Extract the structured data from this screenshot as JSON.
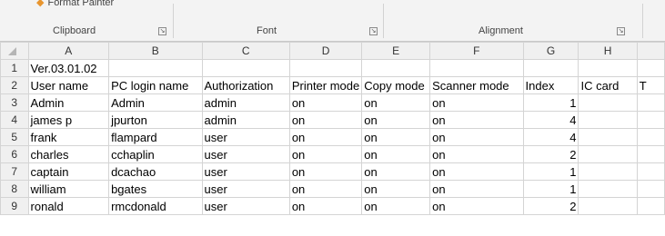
{
  "ribbon": {
    "format_painter_label": "Format Painter",
    "groups": {
      "clipboard": "Clipboard",
      "font": "Font",
      "alignment": "Alignment"
    }
  },
  "columns": [
    "A",
    "B",
    "C",
    "D",
    "E",
    "F",
    "G",
    "H"
  ],
  "rows": [
    [
      "Ver.03.01.02",
      "",
      "",
      "",
      "",
      "",
      "",
      ""
    ],
    [
      "User name",
      "PC login name",
      "Authorization",
      "Printer mode",
      "Copy mode",
      "Scanner mode",
      "Index",
      "IC card"
    ],
    [
      "Admin",
      "Admin",
      "admin",
      "on",
      "on",
      "on",
      "1",
      ""
    ],
    [
      "james p",
      "jpurton",
      "admin",
      "on",
      "on",
      "on",
      "4",
      ""
    ],
    [
      "frank",
      "flampard",
      "user",
      "on",
      "on",
      "on",
      "4",
      ""
    ],
    [
      "charles",
      "cchaplin",
      "user",
      "on",
      "on",
      "on",
      "2",
      ""
    ],
    [
      "captain",
      "dcachao",
      "user",
      "on",
      "on",
      "on",
      "1",
      ""
    ],
    [
      "william",
      "bgates",
      "user",
      "on",
      "on",
      "on",
      "1",
      ""
    ],
    [
      "ronald",
      "rmcdonald",
      "user",
      "on",
      "on",
      "on",
      "2",
      ""
    ]
  ],
  "overflow_text": "T"
}
